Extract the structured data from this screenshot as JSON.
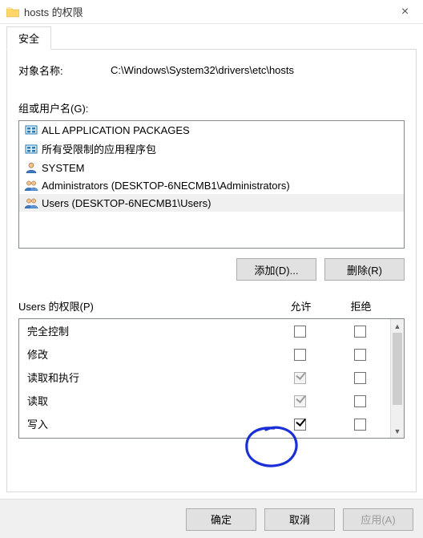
{
  "titlebar": {
    "title": "hosts 的权限",
    "close_glyph": "×"
  },
  "tabs": {
    "security": "安全"
  },
  "object": {
    "label": "对象名称:",
    "value": "C:\\Windows\\System32\\drivers\\etc\\hosts"
  },
  "groups": {
    "label": "组或用户名(G):",
    "items": [
      {
        "name": "ALL APPLICATION PACKAGES",
        "icon": "pkg"
      },
      {
        "name": "所有受限制的应用程序包",
        "icon": "pkg"
      },
      {
        "name": "SYSTEM",
        "icon": "user"
      },
      {
        "name": "Administrators (DESKTOP-6NECMB1\\Administrators)",
        "icon": "group"
      },
      {
        "name": "Users (DESKTOP-6NECMB1\\Users)",
        "icon": "group"
      }
    ],
    "selected_index": 4,
    "add_button": "添加(D)...",
    "remove_button": "删除(R)"
  },
  "permissions": {
    "label": "Users 的权限(P)",
    "allow_col": "允许",
    "deny_col": "拒绝",
    "rows": [
      {
        "name": "完全控制",
        "allow": false,
        "allow_gray": false,
        "deny": false
      },
      {
        "name": "修改",
        "allow": false,
        "allow_gray": false,
        "deny": false
      },
      {
        "name": "读取和执行",
        "allow": true,
        "allow_gray": true,
        "deny": false
      },
      {
        "name": "读取",
        "allow": true,
        "allow_gray": true,
        "deny": false
      },
      {
        "name": "写入",
        "allow": true,
        "allow_gray": false,
        "deny": false
      }
    ]
  },
  "footer": {
    "ok": "确定",
    "cancel": "取消",
    "apply": "应用(A)"
  }
}
